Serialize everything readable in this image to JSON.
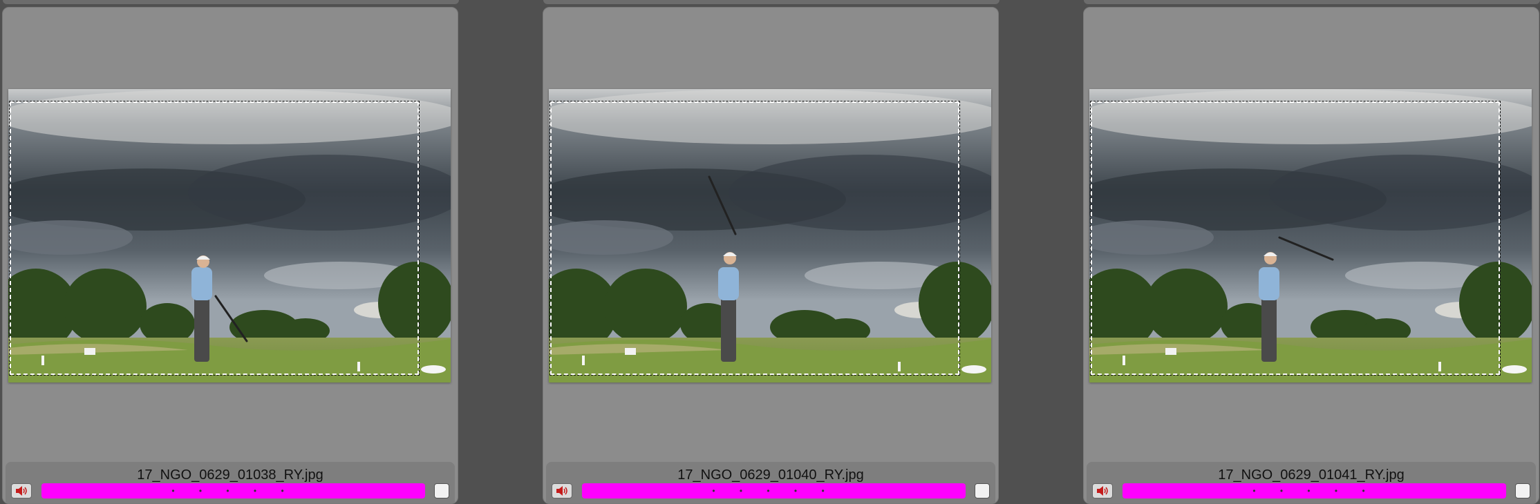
{
  "colors": {
    "label_color": "#ff00ff",
    "background": "#505050",
    "cell": "#8c8c8c"
  },
  "cells": [
    {
      "filename": "17_NGO_0629_01038_RY.jpg",
      "rating_stars": "• • • • •",
      "club_pose": "follow-through"
    },
    {
      "filename": "17_NGO_0629_01040_RY.jpg",
      "rating_stars": "• • • • •",
      "club_pose": "club-up"
    },
    {
      "filename": "17_NGO_0629_01041_RY.jpg",
      "rating_stars": "• • • • •",
      "club_pose": "club-behind"
    }
  ],
  "icons": {
    "audio": "speaker-icon",
    "select": "checkbox-icon"
  }
}
